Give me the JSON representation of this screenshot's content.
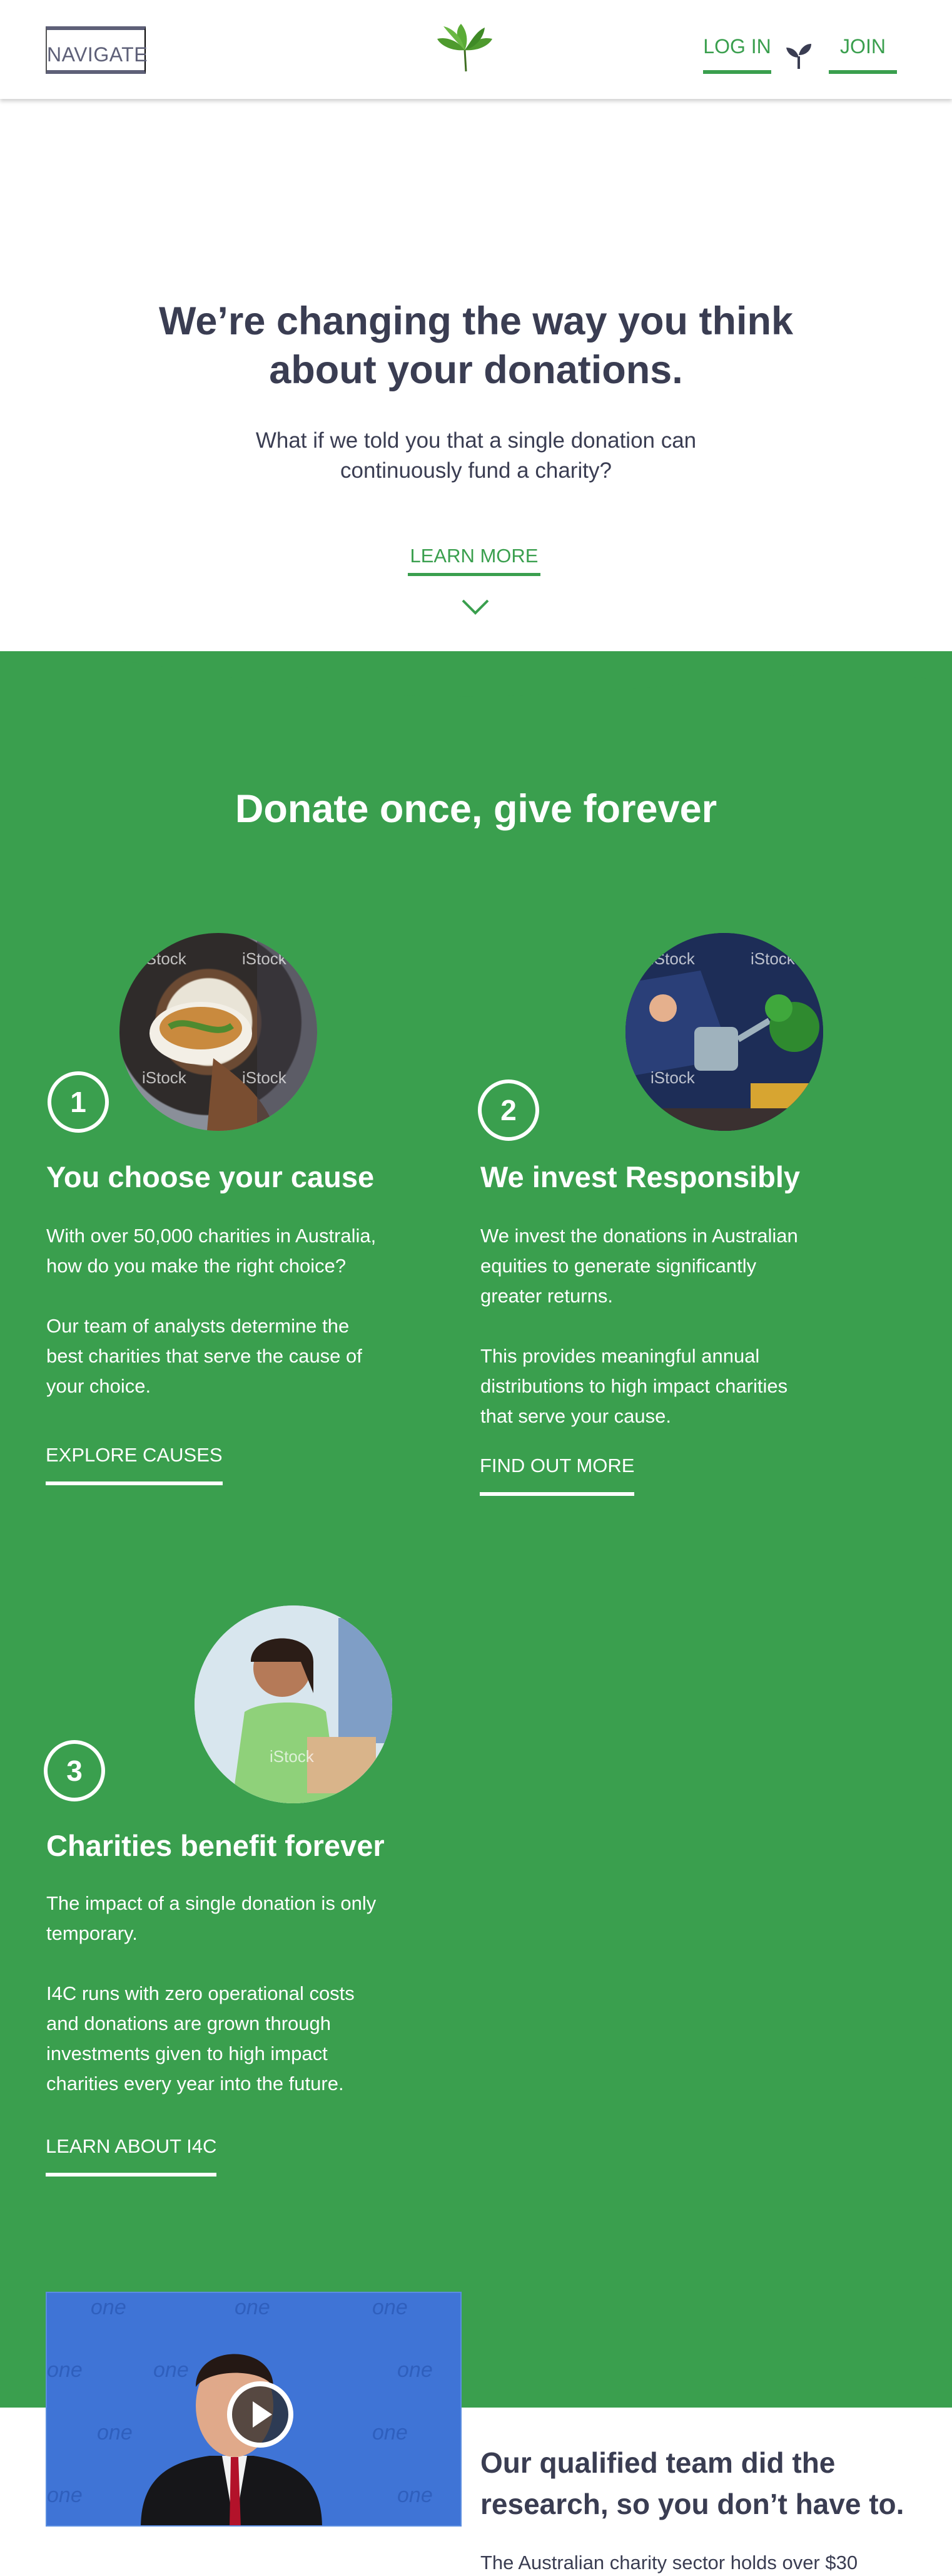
{
  "header": {
    "navigate_label": "NAVIGATE",
    "login_label": "LOG IN",
    "join_label": "JOIN",
    "logo_icon": "leaf-logo-icon",
    "sprout_icon": "sprout-icon"
  },
  "hero": {
    "title_line1": "We’re changing the way you think",
    "title_line2": "about your donations.",
    "subtitle_line1": "What if we told you that a single donation can",
    "subtitle_line2": "continuously fund a charity?",
    "learn_more": "LEARN MORE"
  },
  "how": {
    "title": "Donate once, give forever",
    "steps": [
      {
        "number": "1",
        "title": "You choose your cause",
        "para1": [
          "With over 50,000 charities in Australia,",
          "how do you make the right choice?"
        ],
        "para2": [
          "Our team of analysts determine the",
          "best charities that serve the cause of",
          "your choice."
        ],
        "link": "EXPLORE CAUSES"
      },
      {
        "number": "2",
        "title": "We invest Responsibly",
        "para1": [
          "We invest the donations in Australian",
          "equities to generate significantly",
          "greater returns."
        ],
        "para2": [
          "This provides meaningful annual",
          "distributions to high impact charities",
          "that serve your cause."
        ],
        "link": "FIND OUT MORE"
      },
      {
        "number": "3",
        "title": "Charities benefit forever",
        "para1": [
          "The impact of a single donation is only",
          "temporary."
        ],
        "para2": [
          "I4C runs with zero operational costs",
          "and donations are grown through",
          "investments given to high impact",
          "charities every year into the future."
        ],
        "link": "LEARN ABOUT I4C"
      }
    ],
    "watermark": "iStock"
  },
  "team": {
    "video_backdrop_text": "one",
    "title_line1": "Our qualified team did the",
    "title_line2": "research, so you don’t have to.",
    "text_line1": "The Australian charity sector holds over $30"
  },
  "colors": {
    "green": "#3a9f4e",
    "navy_text": "#3a3d52",
    "white": "#ffffff"
  }
}
